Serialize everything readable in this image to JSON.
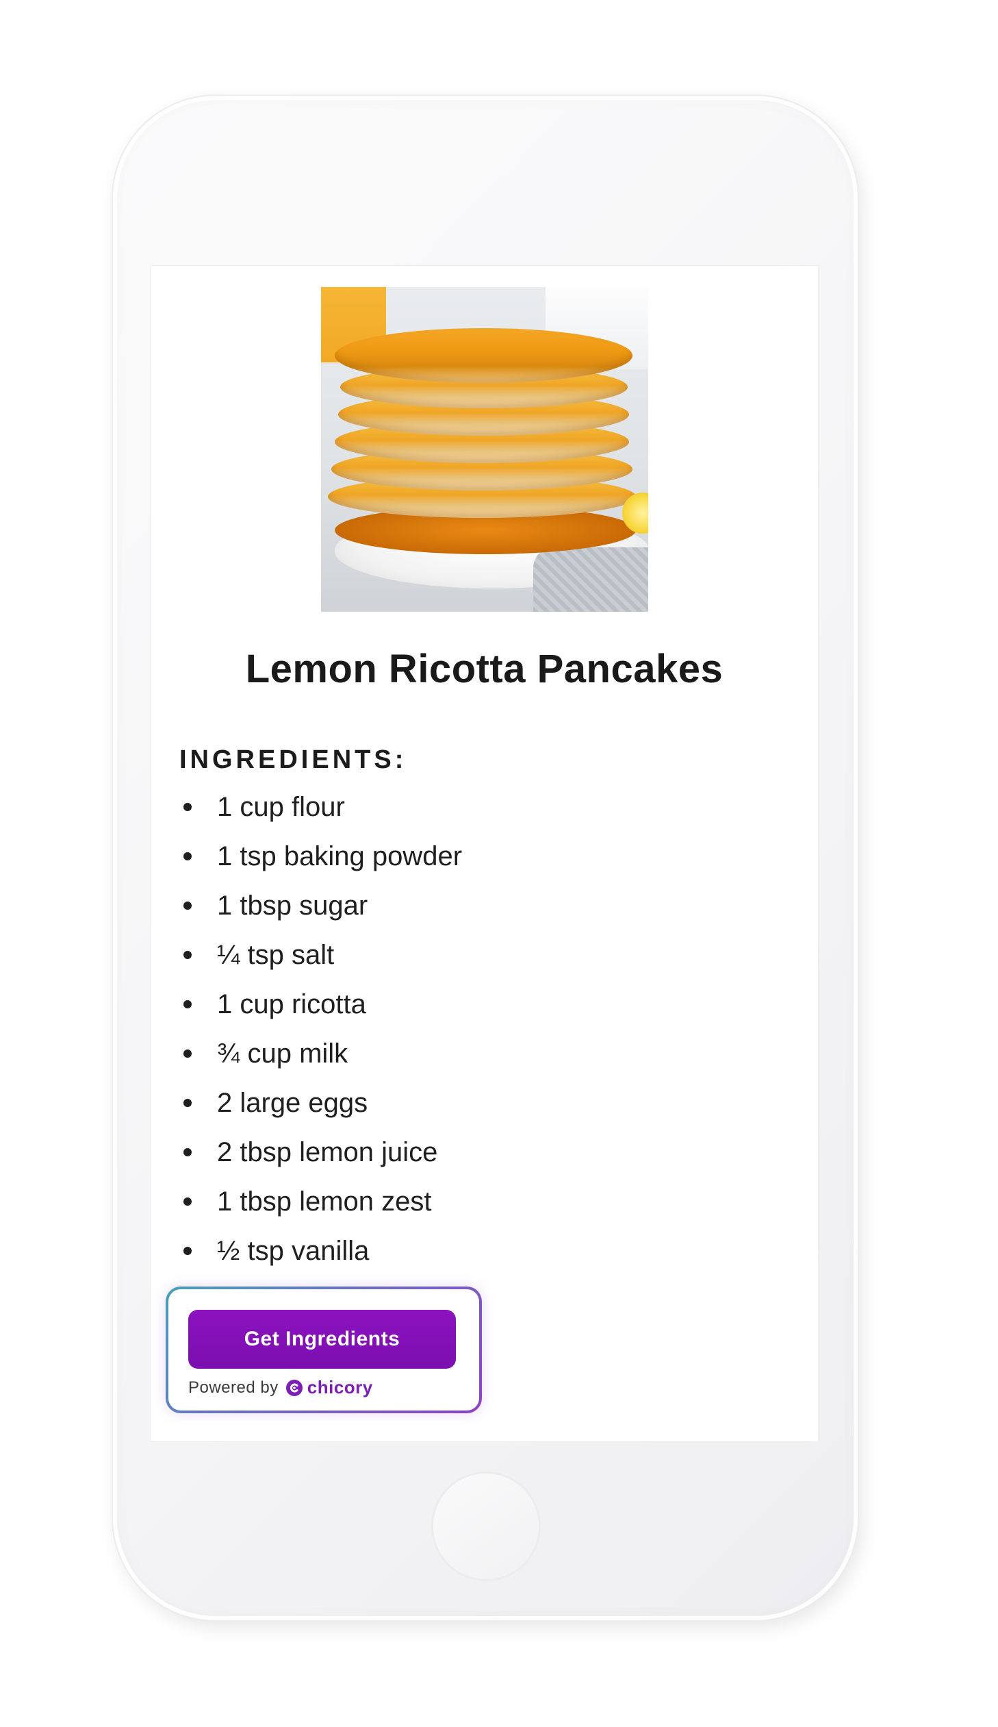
{
  "recipe": {
    "title": "Lemon Ricotta Pancakes",
    "image_alt": "Stack of lemon ricotta pancakes with syrup",
    "ingredients_heading": "INGREDIENTS:",
    "ingredients": [
      "1 cup flour",
      "1 tsp baking powder",
      "1 tbsp sugar",
      "¼ tsp salt",
      "1 cup ricotta",
      "¾ cup milk",
      "2 large eggs",
      "2 tbsp lemon juice",
      "1 tbsp lemon zest",
      "½ tsp vanilla"
    ]
  },
  "widget": {
    "button_label": "Get Ingredients",
    "powered_by": "Powered by",
    "brand": "chicory",
    "brand_color": "#7b1fb5",
    "button_color": "#8c12c0"
  }
}
